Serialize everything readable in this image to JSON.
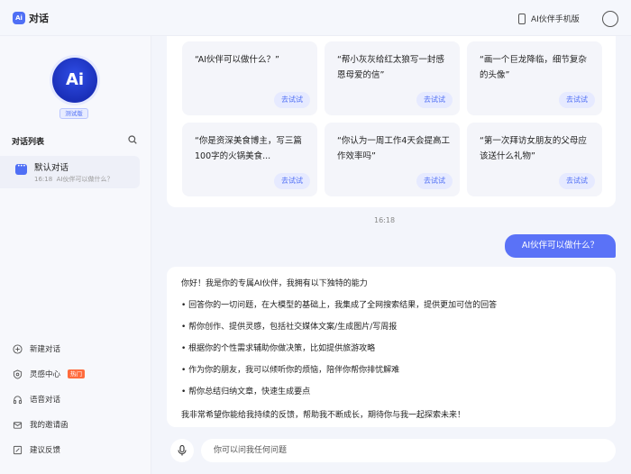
{
  "header": {
    "logo_text": "Ai",
    "title": "对话",
    "phone_link": "AI伙伴手机版"
  },
  "sidebar": {
    "bot_logo_text": "Ai",
    "badge": "测试版",
    "list_title": "对话列表",
    "conversation": {
      "title": "默认对话",
      "time": "16:18",
      "preview": "AI伙伴可以做什么？"
    },
    "menu": [
      {
        "label": "新建对话",
        "icon": "plus-circle-icon"
      },
      {
        "label": "灵感中心",
        "icon": "shield-icon",
        "badge": "热门"
      },
      {
        "label": "语音对话",
        "icon": "headphones-icon"
      },
      {
        "label": "我的邀请函",
        "icon": "envelope-icon"
      },
      {
        "label": "建议反馈",
        "icon": "edit-icon"
      }
    ]
  },
  "suggestions": {
    "button_label": "去试试",
    "cards": [
      {
        "text": "“AI伙伴可以做什么？”"
      },
      {
        "text": "“帮小灰灰给红太狼写一封感恩母爱的信”"
      },
      {
        "text": "“画一个巨龙降临，细节复杂的头像”"
      },
      {
        "text": "“你是资深美食博主，写三篇100字的火锅美食..."
      },
      {
        "text": "“你认为一周工作4天会提高工作效率吗”"
      },
      {
        "text": "“第一次拜访女朋友的父母应该送什么礼物”"
      }
    ]
  },
  "chat": {
    "time": "16:18",
    "user_message": "AI伙伴可以做什么？",
    "bot_lines": [
      "你好！我是你的专属AI伙伴，我拥有以下独特的能力",
      "• 回答你的一切问题，在大模型的基础上，我集成了全网搜索结果，提供更加可信的回答",
      "• 帮你创作、提供灵感，包括社交媒体文案/生成图片/写周报",
      "• 根据你的个性需求辅助你做决策，比如提供旅游攻略",
      "• 作为你的朋友，我可以倾听你的烦恼，陪伴你帮你排忧解难",
      "• 帮你总结归纳文章，快速生成要点",
      "我非常希望你能给我持续的反馈，帮助我不断成长，期待你与我一起探索未来！"
    ]
  },
  "input": {
    "placeholder": "你可以问我任何问题"
  },
  "colors": {
    "accent": "#4f6ff5",
    "user_bubble": "#5a72f7",
    "hot": "#ff6b3d"
  }
}
